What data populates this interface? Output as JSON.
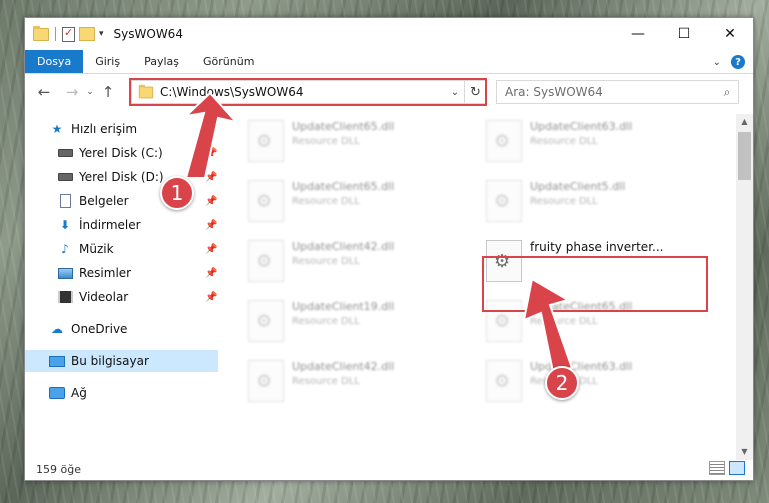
{
  "window": {
    "title": "SysWOW64",
    "minimize_glyph": "—",
    "maximize_glyph": "☐",
    "close_glyph": "✕"
  },
  "ribbon": {
    "tabs": [
      "Dosya",
      "Giriş",
      "Paylaş",
      "Görünüm"
    ],
    "active_tab": "Dosya",
    "help_glyph": "?",
    "expand_glyph": "⌄"
  },
  "nav": {
    "back_glyph": "←",
    "forward_glyph": "→",
    "recent_glyph": "⌄",
    "up_glyph": "↑",
    "address": "C:\\Windows\\SysWOW64",
    "search_placeholder": "Ara: SysWOW64"
  },
  "sidebar": {
    "items": [
      {
        "label": "Hızlı erişim",
        "icon": "star-icon",
        "pinned": false
      },
      {
        "label": "Yerel Disk (C:)",
        "icon": "drive-icon",
        "pinned": true
      },
      {
        "label": "Yerel Disk (D:)",
        "icon": "drive-icon",
        "pinned": true
      },
      {
        "label": "Belgeler",
        "icon": "documents-icon",
        "pinned": true
      },
      {
        "label": "İndirmeler",
        "icon": "downloads-icon",
        "pinned": true
      },
      {
        "label": "Müzik",
        "icon": "music-icon",
        "pinned": true
      },
      {
        "label": "Resimler",
        "icon": "pictures-icon",
        "pinned": true
      },
      {
        "label": "Videolar",
        "icon": "videos-icon",
        "pinned": true
      },
      {
        "label": "OneDrive",
        "icon": "cloud-icon",
        "pinned": false
      },
      {
        "label": "Bu bilgisayar",
        "icon": "computer-icon",
        "pinned": false,
        "selected": true
      },
      {
        "label": "Ağ",
        "icon": "network-icon",
        "pinned": false
      }
    ]
  },
  "files": [
    {
      "name": "UpdateClient65.dll",
      "type": "Resource DLL"
    },
    {
      "name": "UpdateClient63.dll",
      "type": "Resource DLL"
    },
    {
      "name": "UpdateClient65.dll",
      "type": "Resource DLL"
    },
    {
      "name": "UpdateClient5.dll",
      "type": "Resource DLL"
    },
    {
      "name": "UpdateClient42.dll",
      "type": "Resource DLL"
    },
    {
      "name": "fruity phase inverter...",
      "type": ""
    },
    {
      "name": "UpdateClient19.dll",
      "type": "Resource DLL"
    },
    {
      "name": "UpdateClient65.dll",
      "type": "Resource DLL"
    },
    {
      "name": "UpdateClient42.dll",
      "type": "Resource DLL"
    },
    {
      "name": "UpdateClient63.dll",
      "type": "Resource DLL"
    }
  ],
  "status": {
    "item_count": "159 öğe"
  },
  "annotations": {
    "step1": "1",
    "step2": "2",
    "color": "#d9434a"
  }
}
